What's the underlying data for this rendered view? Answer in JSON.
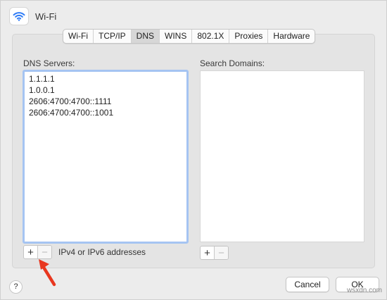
{
  "window": {
    "title": "Wi-Fi",
    "icon": "wifi-icon"
  },
  "tabs": [
    {
      "label": "Wi-Fi",
      "active": false
    },
    {
      "label": "TCP/IP",
      "active": false
    },
    {
      "label": "DNS",
      "active": true
    },
    {
      "label": "WINS",
      "active": false
    },
    {
      "label": "802.1X",
      "active": false
    },
    {
      "label": "Proxies",
      "active": false
    },
    {
      "label": "Hardware",
      "active": false
    }
  ],
  "dns": {
    "label": "DNS Servers:",
    "servers": [
      "1.1.1.1",
      "1.0.0.1",
      "2606:4700:4700::1111",
      "2606:4700:4700::1001"
    ],
    "add_symbol": "+",
    "remove_symbol": "−",
    "hint": "IPv4 or IPv6 addresses"
  },
  "search": {
    "label": "Search Domains:",
    "domains": [],
    "add_symbol": "+",
    "remove_symbol": "−"
  },
  "footer": {
    "help_label": "?",
    "cancel_label": "Cancel",
    "ok_label": "OK"
  },
  "watermark": "wsxdn.com",
  "colors": {
    "focus_ring": "#a5c4f2",
    "arrow": "#e8371f",
    "wifi_icon": "#2f7cf6"
  }
}
